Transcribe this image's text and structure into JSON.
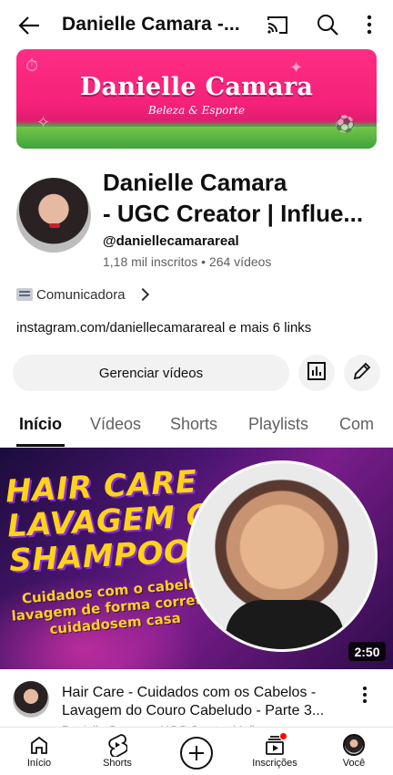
{
  "topbar": {
    "title": "Danielle Camara -...",
    "icons": [
      "back-arrow-icon",
      "cast-icon",
      "search-icon",
      "more-vert-icon"
    ]
  },
  "banner": {
    "title": "Danielle Camara",
    "subtitle": "Beleza & Esporte"
  },
  "channel": {
    "name_line1": "Danielle Camara",
    "name_line2": "- UGC Creator | Influe...",
    "handle": "@daniellecamarareal",
    "stats": "1,18 mil inscritos • 264 vídeos",
    "about": "Comunicadora",
    "links": "instagram.com/daniellecamarareal e mais 6 links"
  },
  "actions": {
    "manage_label": "Gerenciar vídeos",
    "icons": [
      "analytics-icon",
      "edit-pencil-icon"
    ]
  },
  "tabs": [
    {
      "label": "Início",
      "active": true
    },
    {
      "label": "Vídeos",
      "active": false
    },
    {
      "label": "Shorts",
      "active": false
    },
    {
      "label": "Playlists",
      "active": false
    },
    {
      "label": "Com",
      "active": false
    }
  ],
  "video": {
    "thumb_title": "HAIR CARE\nLAVAGEM COM\nSHAMPOO",
    "thumb_caption": "Cuidados com o cabelo,\nlavagem de forma correta,\ncuidadosem casa",
    "duration": "2:50",
    "title_line1": "Hair Care - Cuidados com os Cabelos -",
    "title_line2": "Lavagem do Couro Cabeludo - Parte 3...",
    "meta": "Danielle Camara - UGC Creator | Influe..."
  },
  "bottomnav": {
    "items": [
      {
        "label": "Início",
        "icon": "home-icon"
      },
      {
        "label": "Shorts",
        "icon": "shorts-icon"
      },
      {
        "label": "",
        "icon": "create-plus-icon"
      },
      {
        "label": "Inscrições",
        "icon": "subscriptions-icon"
      },
      {
        "label": "Você",
        "icon": "you-avatar-icon"
      }
    ]
  },
  "colors": {
    "text": "#0f0f0f",
    "secondary": "#606060",
    "chip_bg": "#f2f2f2",
    "notification": "#ff0000"
  }
}
